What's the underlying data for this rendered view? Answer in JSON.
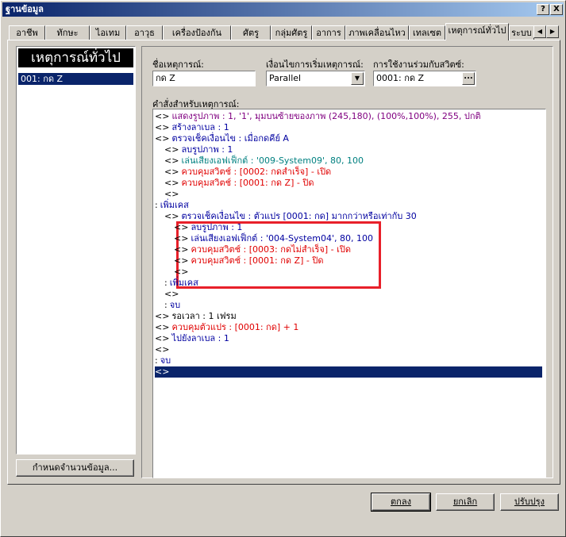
{
  "window": {
    "title": "ฐานข้อมูล",
    "help_glyph": "?",
    "close_glyph": "X"
  },
  "tabs": [
    "อาชีพ",
    "ทักษะ",
    "ไอเทม",
    "อาวุธ",
    "เครื่องป้องกัน",
    "ศัตรู",
    "กลุ่มศัตรู",
    "อาการ",
    "ภาพเคลื่อนไหว",
    "เทลเซต",
    "เหตุการณ์ทั่วไป",
    "ระบบ"
  ],
  "tab_scroll": {
    "left": "◀",
    "right": "▶"
  },
  "left_panel": {
    "header": "เหตุการณ์ทั่วไป",
    "items": [
      "001: กด Z"
    ],
    "button": "กำหนดจำนวนข้อมูล..."
  },
  "form": {
    "name_label": "ชื่อเหตุการณ์:",
    "name_value": "กด Z",
    "trigger_label": "เงื่อนไขการเริ่มเหตุการณ์:",
    "trigger_value": "Parallel",
    "switch_label": "การใช้งานร่วมกับสวิตซ์:",
    "switch_value": "0001: กด Z",
    "switch_button": "...",
    "commands_label": "คำสั่งสำหรับเหตุการณ์:"
  },
  "commands": [
    {
      "prefix": "<>",
      "text": "แสดงรูปภาพ : 1, '1', มุมบนซ้ายของภาพ (245,180), (100%,100%), 255, ปกติ",
      "color": "#800080"
    },
    {
      "prefix": "<>",
      "text": "สร้างลาเบล : 1",
      "color": "#0000a0"
    },
    {
      "prefix": "<>",
      "text": "ตรวจเช็คเงื่อนไข : เมื่อกดคีย์ A",
      "color": "#0000a0"
    },
    {
      "prefix": "<>",
      "text": "ลบรูปภาพ : 1",
      "color": "#0000a0"
    },
    {
      "prefix": "<>",
      "text": "เล่นเสียงเอฟเฟ็กต์ : '009-System09', 80, 100",
      "color": "#008080"
    },
    {
      "prefix": "<>",
      "text": "ควบคุมสวิตช์ : [0002: กดสำเร็จ] - เปิด",
      "color": "#e00000"
    },
    {
      "prefix": "<>",
      "text": "ควบคุมสวิตช์ : [0001: กด Z] - ปิด",
      "color": "#e00000"
    },
    {
      "prefix": "<>",
      "text": "",
      "color": "#000000"
    },
    {
      "prefix": ":",
      "text": "เพิ่มเคส",
      "color": "#0000a0"
    },
    {
      "prefix": "<>",
      "text": "ตรวจเช็คเงื่อนไข : ตัวแปร [0001: กด] มากกว่าหรือเท่ากับ 30",
      "color": "#0000a0"
    },
    {
      "prefix": "<>",
      "text": "ลบรูปภาพ : 1",
      "color": "#0000a0"
    },
    {
      "prefix": "<>",
      "text": "เล่นเสียงเอฟเฟ็กต์ : '004-System04', 80, 100",
      "color": "#0000a0"
    },
    {
      "prefix": "<>",
      "text": "ควบคุมสวิตช์ : [0003: กดไม่สำเร็จ] - เปิด",
      "color": "#e00000"
    },
    {
      "prefix": "<>",
      "text": "ควบคุมสวิตช์ : [0001: กด Z] - ปิด",
      "color": "#e00000"
    },
    {
      "prefix": "<>",
      "text": "",
      "color": "#000000"
    },
    {
      "prefix": ":",
      "text": "เพิ่มเคส",
      "color": "#0000a0"
    },
    {
      "prefix": "<>",
      "text": "",
      "color": "#000000"
    },
    {
      "prefix": ":",
      "text": "จบ",
      "color": "#0000a0"
    },
    {
      "prefix": "<>",
      "text": "รอเวลา : 1 เฟรม",
      "color": "#000000"
    },
    {
      "prefix": "<>",
      "text": "ควบคุมตัวแปร : [0001: กด] + 1",
      "color": "#e00000"
    },
    {
      "prefix": "<>",
      "text": "ไปยังลาเบล : 1",
      "color": "#0000a0"
    },
    {
      "prefix": "<>",
      "text": "",
      "color": "#000000"
    },
    {
      "prefix": ":",
      "text": "จบ",
      "color": "#0000a0"
    },
    {
      "prefix": "<>",
      "text": "",
      "color": "#ffffff"
    }
  ],
  "buttons": {
    "ok": "ตกลง",
    "cancel": "ยกเลิก",
    "apply": "ปรับปรุง"
  },
  "colors": {
    "highlight": "#0a246a",
    "annotation": "#e8202a"
  }
}
